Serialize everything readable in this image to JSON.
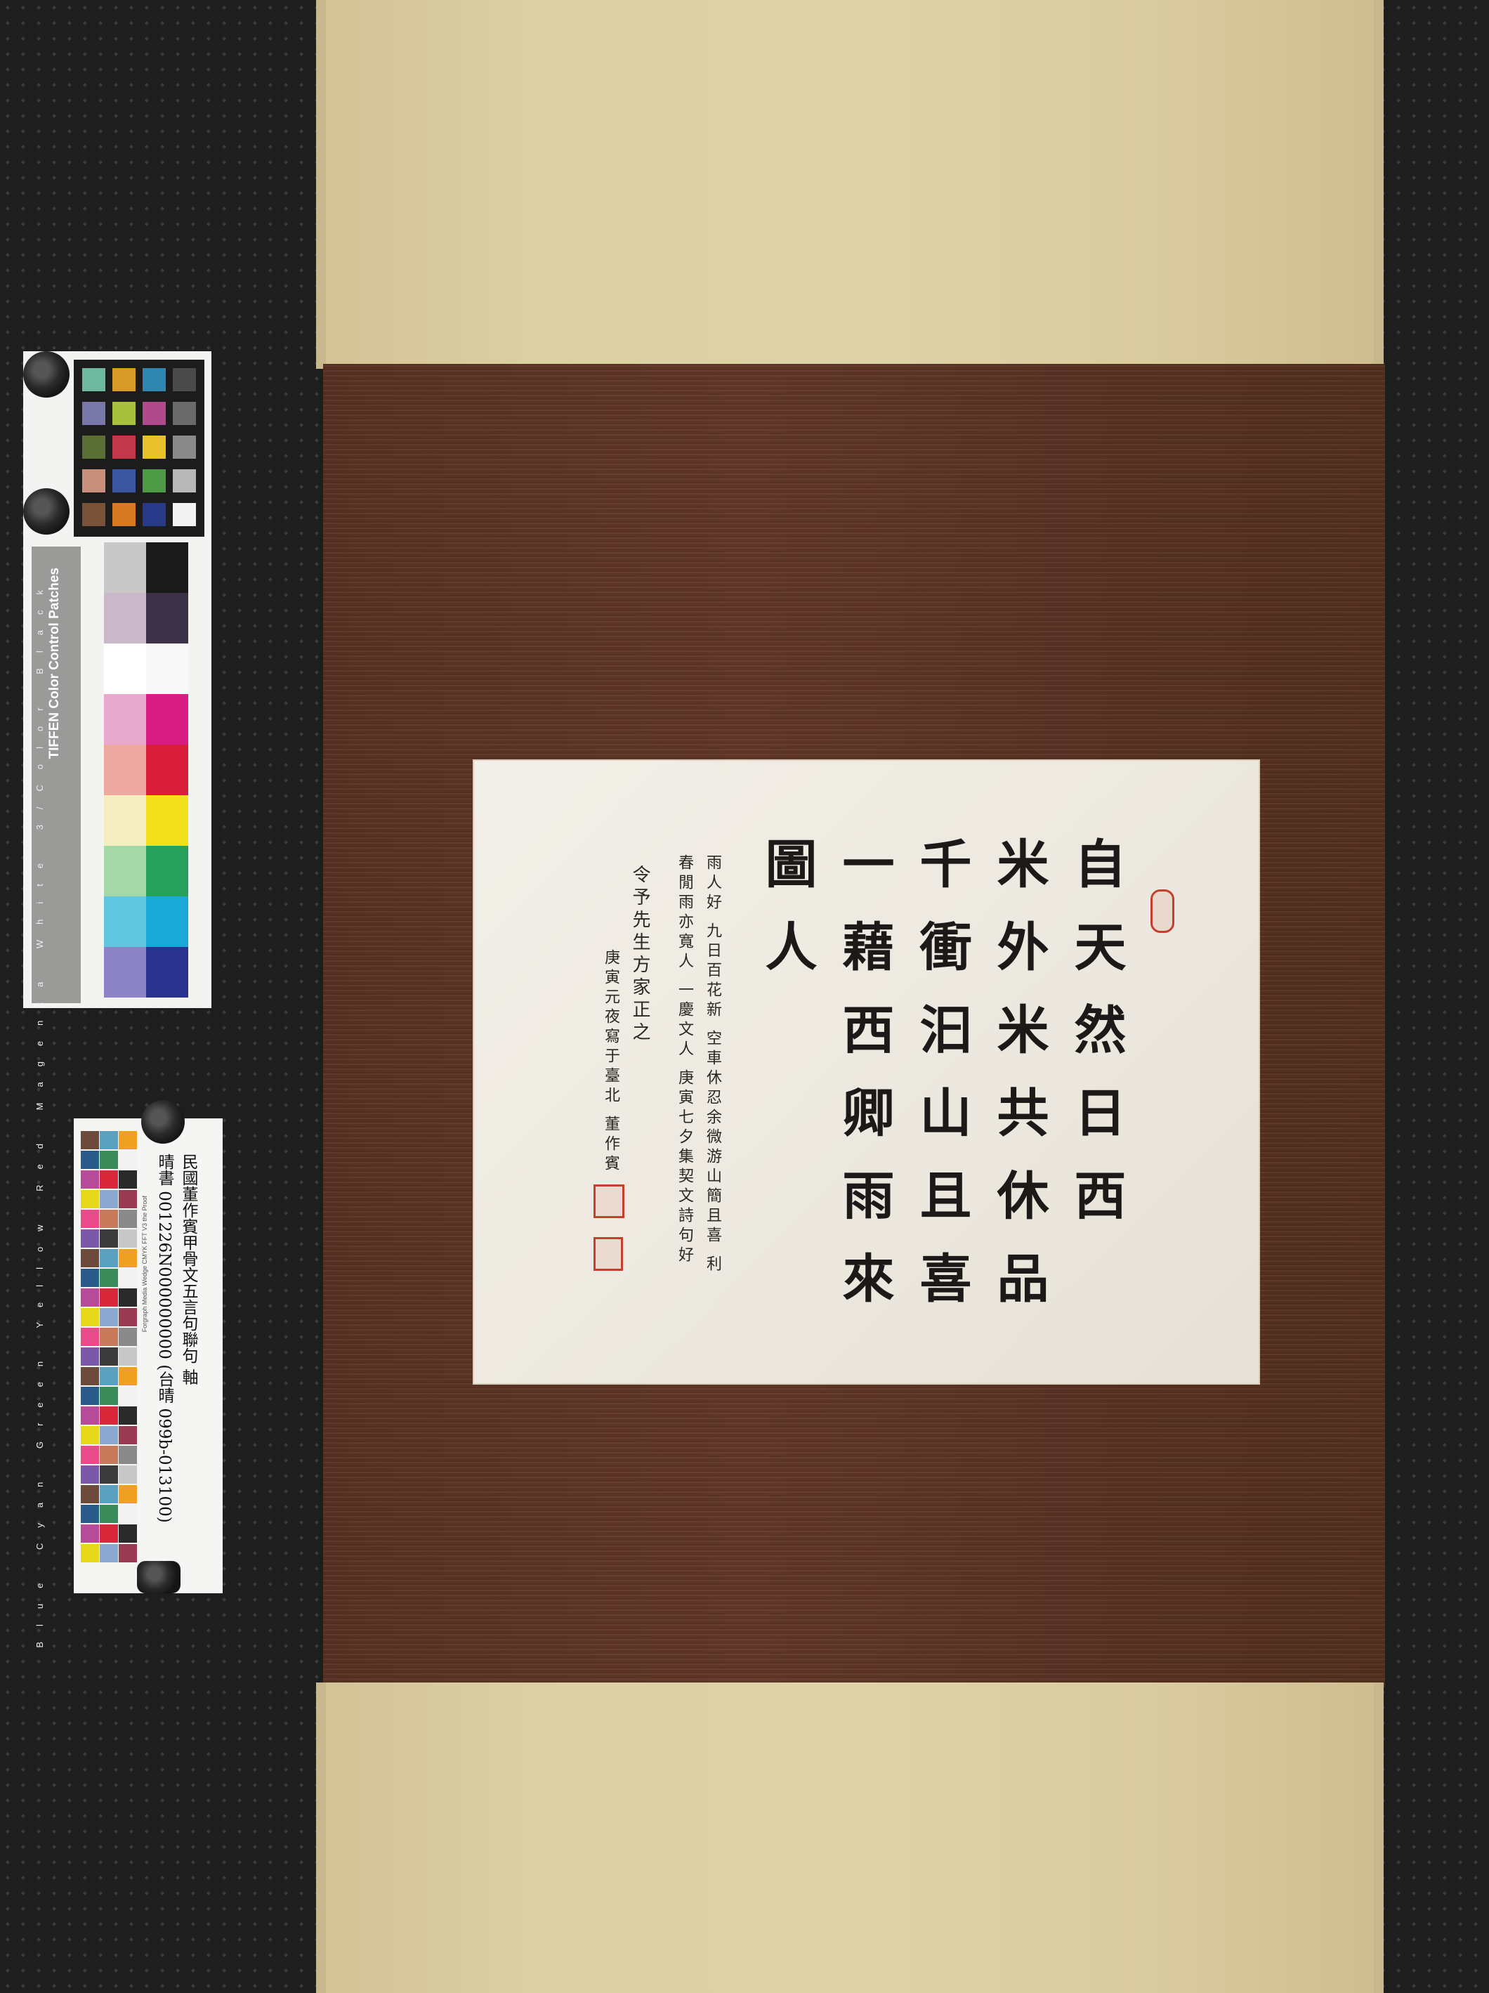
{
  "scene": {
    "colors": {
      "backdrop": "#1e1e1f",
      "silk_mounting": "#dccfa4",
      "brocade_border": "#5d3526",
      "paper": "#ece8df",
      "ink": "#1b1a18",
      "seal_red": "#c5402c"
    }
  },
  "artwork": {
    "main_lines": [
      "自天然日西",
      "米外米共休品",
      "千衝汩山且喜",
      "一藉西卿雨來",
      "圖人"
    ],
    "inscription_lines": [
      "雨人好 九日百花新 空車休忍余微游山簡且喜 利",
      "春閒雨亦寬人 一慶文人 庚寅七夕集契文詩句好",
      "令予先生方家正之",
      "庚寅元夜寫于臺北 董作賓"
    ]
  },
  "color_card": {
    "title": "TIFFEN Color Control Patches",
    "strip_labels": "Blue  Cyan  Green  Yellow  Red  Magenta  White  3/Color  Black",
    "checker_patches": [
      "#6fb8a0",
      "#d89a26",
      "#2f86b0",
      "#4a4a4a",
      "#7a78a8",
      "#a8c03c",
      "#b04a8a",
      "#6a6a6a",
      "#5b6f34",
      "#c0384a",
      "#e8c22a",
      "#8a8a8a",
      "#c8907a",
      "#3a56a0",
      "#4e9a46",
      "#b8b8b8",
      "#7a5238",
      "#d87a22",
      "#2a3a8a",
      "#f2f2f2"
    ],
    "ruler_colors": [
      "#8c84c4",
      "#5fc8e0",
      "#a6d7a6",
      "#f4eec0",
      "#eda9a0",
      "#e8a9cf",
      "#ffffff",
      "#c9b8c8",
      "#c8c8c8"
    ],
    "strip_colors": [
      "#2c3290",
      "#1aa8d8",
      "#26a05a",
      "#f2e01a",
      "#d81e3a",
      "#d81e82",
      "#f8f8f8",
      "#3c3248",
      "#1a1a1a"
    ]
  },
  "wedge_card": {
    "catalog_line": "晴書 001226N000000000 (台晴 099b-013100)",
    "title_line": "民國董作賓甲骨文五言句聯句 軸",
    "small_text": "Forgraph Media Wedge CMYK  FFT V3 the Proof"
  }
}
